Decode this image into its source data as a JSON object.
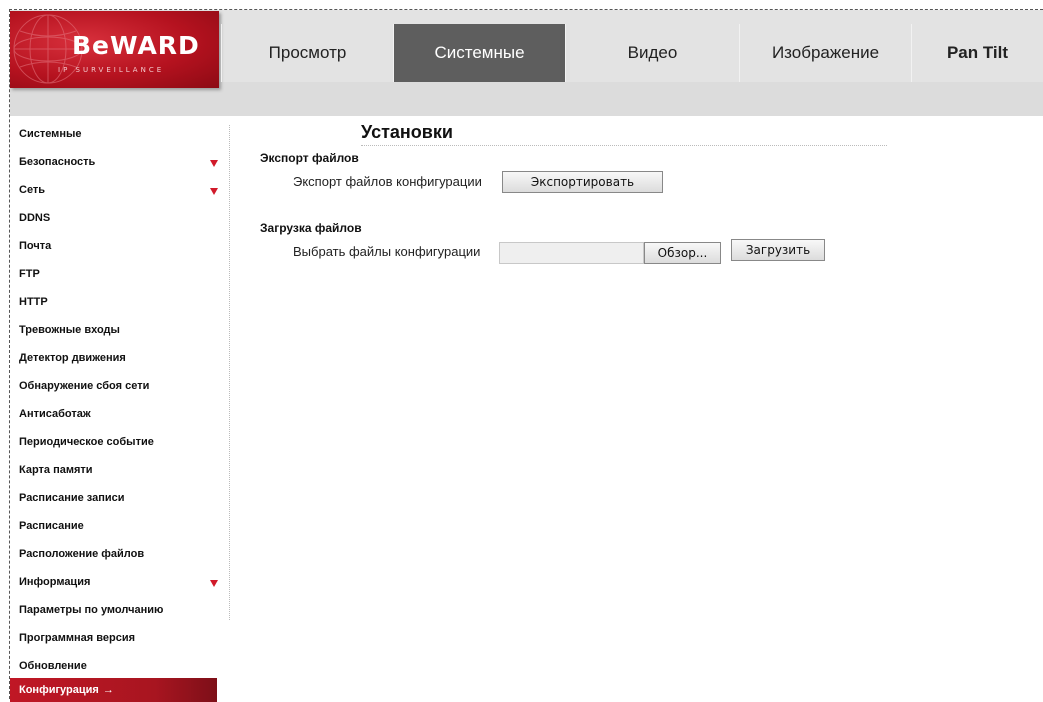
{
  "logo": {
    "text": "BeWARD",
    "sub": "IP SURVEILLANCE"
  },
  "nav": {
    "tabs": [
      {
        "label": "Просмотр"
      },
      {
        "label": "Системные"
      },
      {
        "label": "Видео"
      },
      {
        "label": "Изображение"
      },
      {
        "label": "Pan Tilt"
      }
    ],
    "active": "Системные"
  },
  "sidebar": {
    "items": [
      {
        "label": "Системные"
      },
      {
        "label": "Безопасность",
        "expandable": true
      },
      {
        "label": "Сеть",
        "expandable": true
      },
      {
        "label": "DDNS"
      },
      {
        "label": "Почта"
      },
      {
        "label": "FTP"
      },
      {
        "label": "HTTP"
      },
      {
        "label": "Тревожные входы"
      },
      {
        "label": "Детектор движения"
      },
      {
        "label": "Обнаружение сбоя сети"
      },
      {
        "label": "Антисаботаж"
      },
      {
        "label": "Периодическое событие"
      },
      {
        "label": "Карта памяти"
      },
      {
        "label": "Расписание записи"
      },
      {
        "label": "Расписание"
      },
      {
        "label": "Расположение файлов"
      },
      {
        "label": "Информация",
        "expandable": true
      },
      {
        "label": "Параметры по умолчанию"
      },
      {
        "label": "Программная версия"
      },
      {
        "label": "Обновление"
      },
      {
        "label": "Конфигурация",
        "active": true,
        "arrow": "→"
      }
    ]
  },
  "main": {
    "title": "Установки",
    "export": {
      "section": "Экспорт файлов",
      "label": "Экспорт файлов конфигурации",
      "button": "Экспортировать"
    },
    "upload": {
      "section": "Загрузка файлов",
      "label": "Выбрать файлы конфигурации",
      "browse": "Обзор...",
      "button": "Загрузить"
    }
  },
  "colors": {
    "accent": "#c01725",
    "active_tab": "#5e5e5e",
    "header_bg": "#e3e3e3"
  }
}
